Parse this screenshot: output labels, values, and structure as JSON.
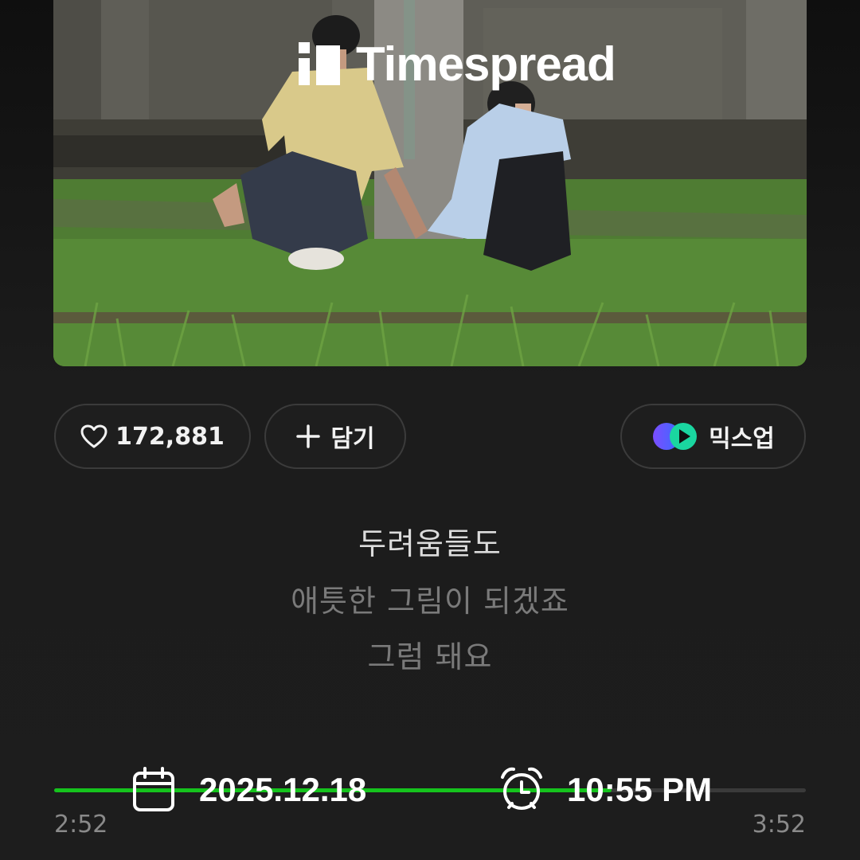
{
  "watermark": {
    "brand": "Timespread"
  },
  "actions": {
    "like_count": "172,881",
    "add_label": "담기",
    "mixup_label": "믹스업"
  },
  "lyrics": {
    "current": "두려움들도",
    "next": [
      "애틋한 그림이 되겠죠",
      "그럼 돼요"
    ]
  },
  "playback": {
    "elapsed": "2:52",
    "total": "3:52",
    "progress": 0.742
  },
  "stamp": {
    "date": "2025.12.18",
    "time": "10:55 PM"
  },
  "colors": {
    "accent": "#15c31d",
    "mixup_purple": "#7b4dff",
    "mixup_teal": "#1ad6a0"
  }
}
